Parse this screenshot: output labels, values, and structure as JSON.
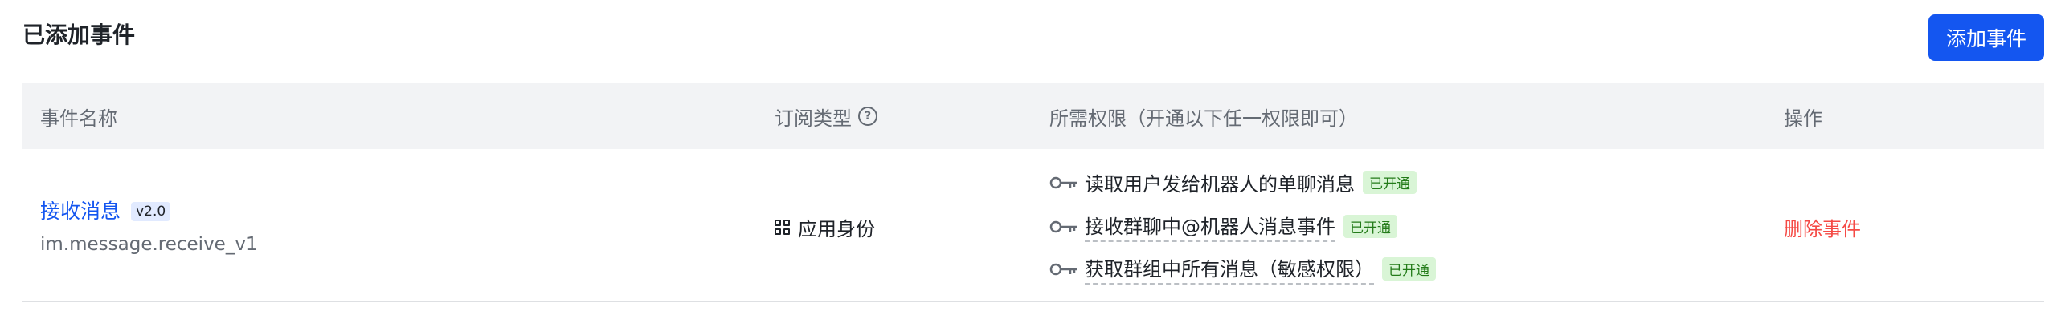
{
  "header": {
    "title": "已添加事件",
    "add_button": "添加事件"
  },
  "table": {
    "columns": {
      "name": "事件名称",
      "subscription_type": "订阅类型",
      "permissions": "所需权限（开通以下任一权限即可）",
      "actions": "操作"
    },
    "rows": [
      {
        "event_name": "接收消息",
        "version": "v2.0",
        "event_key": "im.message.receive_v1",
        "subscription_type": "应用身份",
        "permissions": [
          {
            "label": "读取用户发给机器人的单聊消息",
            "status": "已开通"
          },
          {
            "label": "接收群聊中@机器人消息事件",
            "status": "已开通"
          },
          {
            "label": "获取群组中所有消息（敏感权限）",
            "status": "已开通"
          }
        ],
        "action": "删除事件"
      }
    ]
  },
  "colors": {
    "primary": "#1456f0",
    "danger": "#f54a45",
    "success_bg": "#d9f5d6",
    "success_text": "#237b19",
    "header_bg": "#f2f3f5"
  }
}
